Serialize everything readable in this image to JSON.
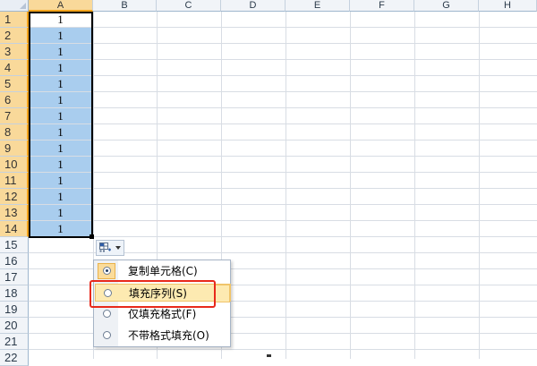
{
  "columns": [
    "A",
    "B",
    "C",
    "D",
    "E",
    "F",
    "G",
    "H"
  ],
  "rows": [
    "1",
    "2",
    "3",
    "4",
    "5",
    "6",
    "7",
    "8",
    "9",
    "10",
    "11",
    "12",
    "13",
    "14",
    "15",
    "16",
    "17",
    "18",
    "19",
    "20",
    "21",
    "22"
  ],
  "cells_A": [
    "1",
    "1",
    "1",
    "1",
    "1",
    "1",
    "1",
    "1",
    "1",
    "1",
    "1",
    "1",
    "1",
    "1"
  ],
  "colors": {
    "selection_fill": "#a9cdee",
    "header_selected": "#f9d99a",
    "highlight_box": "#e8291b",
    "hover_fill": "#fdeab1"
  },
  "autofill_menu": {
    "items": [
      {
        "label": "复制单元格(C)",
        "selected": true
      },
      {
        "label": "填充序列(S)",
        "selected": false
      },
      {
        "label": "仅填充格式(F)",
        "selected": false
      },
      {
        "label": "不带格式填充(O)",
        "selected": false
      }
    ]
  },
  "icons": {
    "autofill_options": "autofill-options-icon",
    "dropdown": "chevron-down-icon"
  }
}
